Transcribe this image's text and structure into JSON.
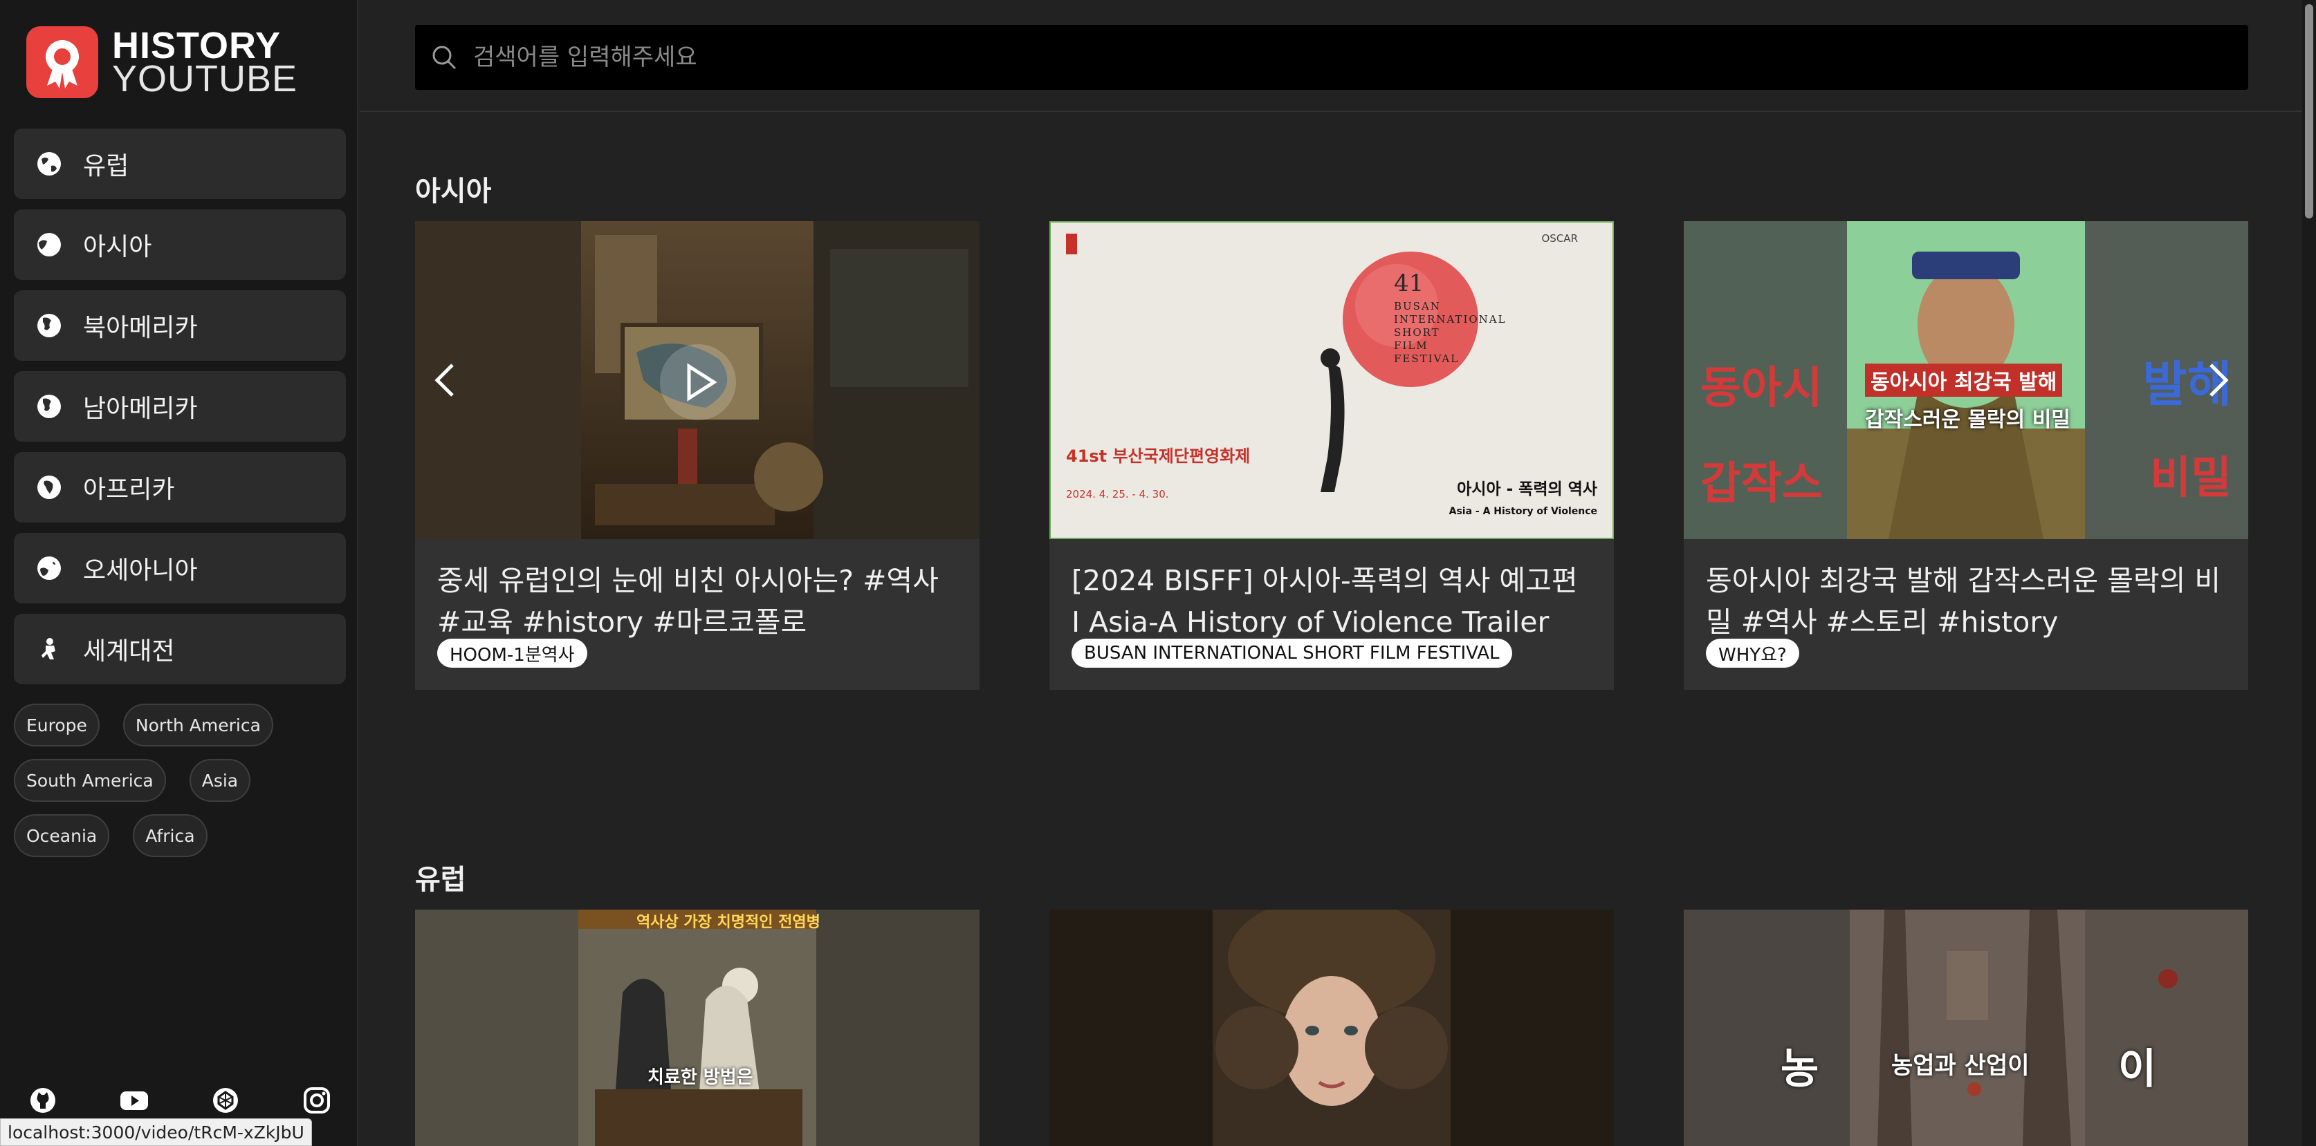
{
  "app": {
    "logo_line1": "HISTORY",
    "logo_line2": "YOUTUBE",
    "accent": "#e8403c"
  },
  "sidebar": {
    "items": [
      {
        "label": "유럽",
        "icon": "globe-europe-icon"
      },
      {
        "label": "아시아",
        "icon": "globe-asia-icon"
      },
      {
        "label": "북아메리카",
        "icon": "globe-americas-icon"
      },
      {
        "label": "남아메리카",
        "icon": "globe-americas-icon"
      },
      {
        "label": "아프리카",
        "icon": "globe-africa-icon"
      },
      {
        "label": "오세아니아",
        "icon": "globe-oceania-icon"
      },
      {
        "label": "세계대전",
        "icon": "soldier-icon"
      }
    ],
    "tags": [
      "Europe",
      "North America",
      "South America",
      "Asia",
      "Oceania",
      "Africa"
    ],
    "socials": [
      "github-icon",
      "youtube-icon",
      "codepen-icon",
      "instagram-icon"
    ]
  },
  "search": {
    "placeholder": "검색어를 입력해주세요"
  },
  "sections": [
    {
      "title": "아시아",
      "videos": [
        {
          "title": "중세 유럽인의 눈에 비친 아시아는? #역사 #교육 #history #마르코폴로",
          "channel": "HOOM-1분역사"
        },
        {
          "title": "[2024 BISFF] 아시아-폭력의 역사 예고편 I Asia-A History of Violence Trailer",
          "channel": "BUSAN INTERNATIONAL SHORT FILM FESTIVAL"
        },
        {
          "title": "동아시아 최강국 발해 갑작스러운 몰락의 비밀 #역사 #스토리 #history",
          "channel": "WHY요?"
        }
      ]
    },
    {
      "title": "유럽",
      "videos": [
        {
          "title": "",
          "channel": ""
        },
        {
          "title": "",
          "channel": ""
        },
        {
          "title": "",
          "channel": ""
        }
      ]
    }
  ],
  "thumb_text": {
    "bisff_number": "41",
    "bisff_name_lines": [
      "BUSAN",
      "INTERNATIONAL",
      "SHORT",
      "FILM",
      "FESTIVAL"
    ],
    "bisff_kr": "41st 부산국제단편영화제",
    "bisff_dates": "2024. 4. 25. - 4. 30.",
    "bisff_title_kr": "아시아 - 폭력의 역사",
    "bisff_title_en": "Asia - A History of Violence",
    "bisff_oscar": "OSCAR",
    "balhae_caption_top": "동아시아 최강국 발해",
    "balhae_caption_bottom": "갑작스러운 몰락의 비밀",
    "balhae_side_left": "동아시",
    "balhae_side_left2": "갑작스",
    "balhae_side_right": "발해",
    "balhae_side_right2": "비밀",
    "plague_caption": "역사상 가장 치명적인 전염병",
    "plague_sub": "치료한 방법은",
    "farm_caption": "농업과 산업이",
    "farm_left": "농",
    "farm_right": "이"
  },
  "status_url": "localhost:3000/video/tRcM-xZkJbU"
}
